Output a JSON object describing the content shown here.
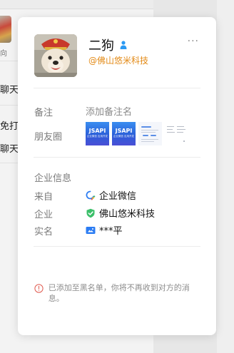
{
  "background": {
    "list_items": [
      {
        "text": "向",
        "small": true
      },
      {
        "text": "聊天"
      },
      {
        "text": "免打"
      },
      {
        "text": "聊天"
      }
    ]
  },
  "profile": {
    "name": "二狗",
    "gender_icon": "male-icon",
    "company_link": "@佛山悠米科技",
    "more_icon": "more-dots-icon",
    "more_label": "···"
  },
  "details": {
    "remark_label": "备注",
    "remark_placeholder": "添加备注名",
    "moments_label": "朋友圈",
    "moments_thumbs": [
      {
        "title": "JSAPI",
        "subtitle": "企业微信 应用开发"
      },
      {
        "title": "JSAPI",
        "subtitle": "企业微信 应用开发"
      }
    ]
  },
  "enterprise": {
    "section_title": "企业信息",
    "source_label": "来自",
    "source_value": "企业微信",
    "source_icon": "wecom-logo-icon",
    "company_label": "企业",
    "company_value": "佛山悠米科技",
    "company_icon": "verified-shield-icon",
    "realname_label": "实名",
    "realname_value": "***平",
    "realname_icon": "id-card-icon"
  },
  "notice": {
    "icon": "warning-circle-icon",
    "text": "已添加至黑名单，你将不再收到对方的消息。"
  },
  "colors": {
    "accent_orange": "#e38a16",
    "verified_green": "#3cbf6a",
    "male_blue": "#2b9af3",
    "warning_red": "#e05a4f"
  }
}
